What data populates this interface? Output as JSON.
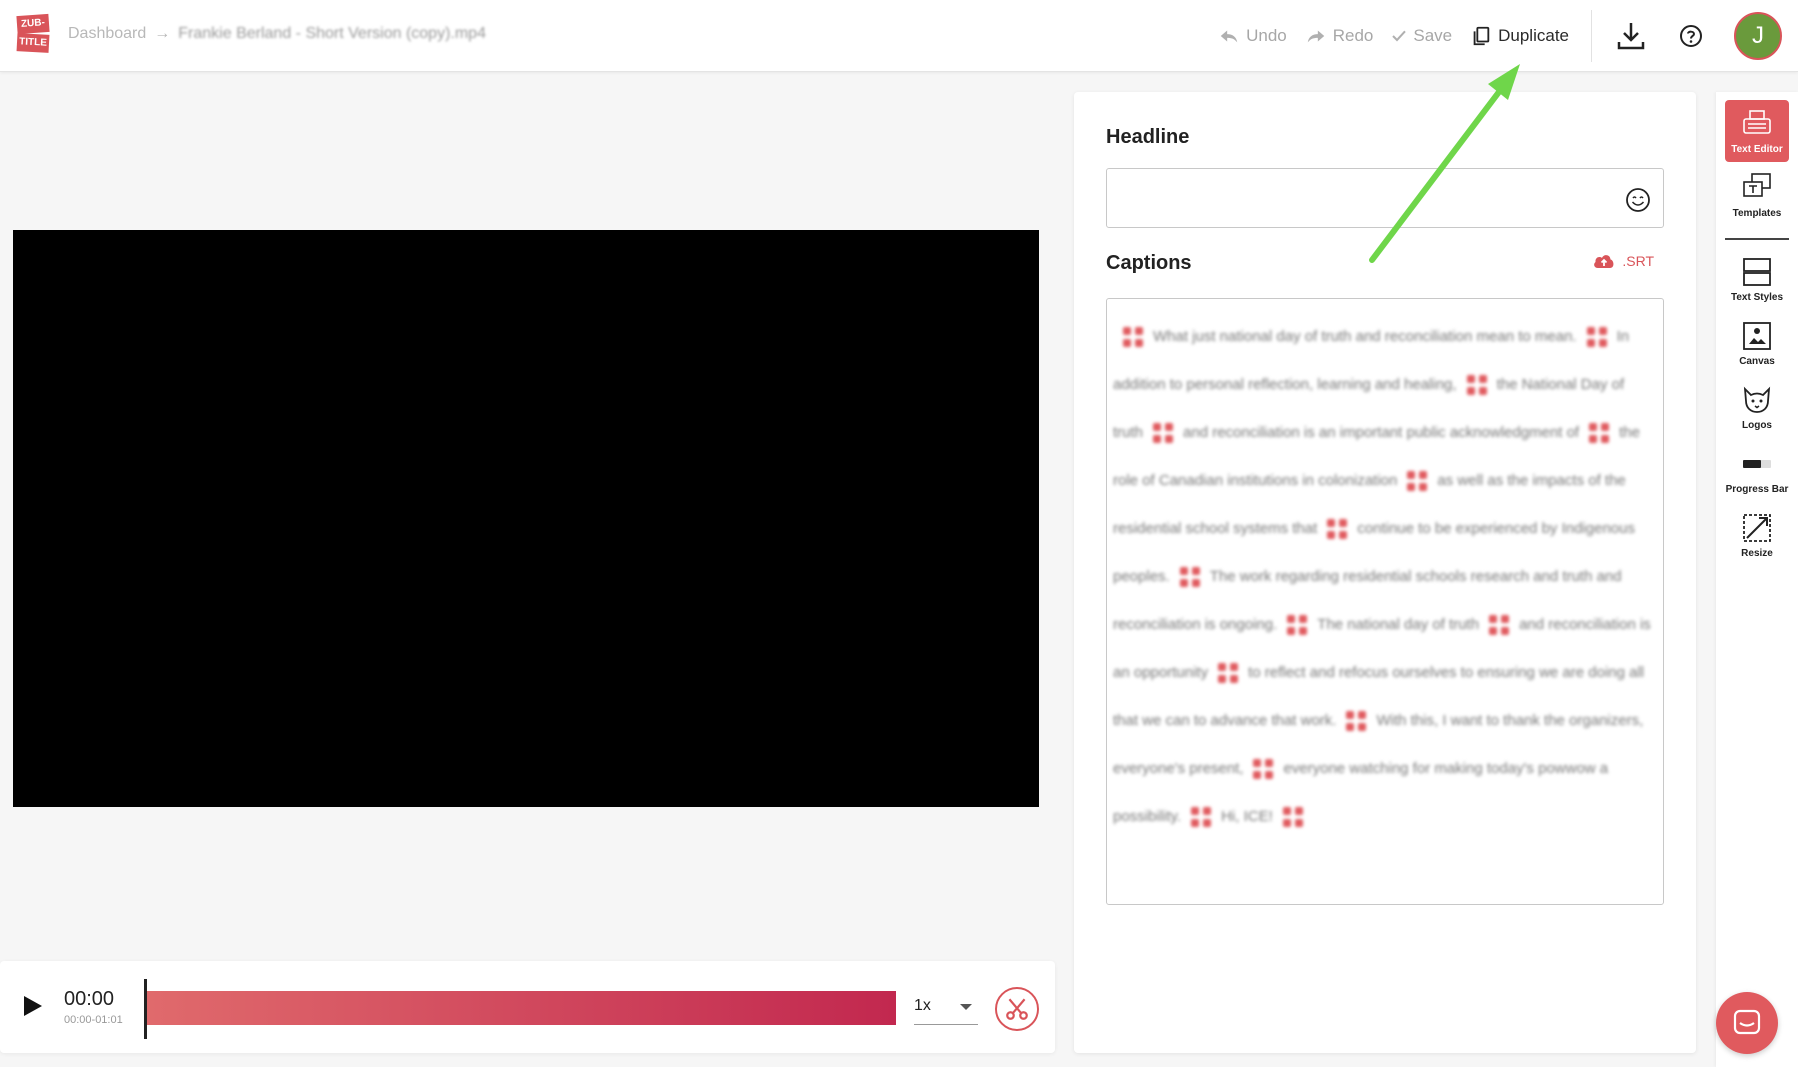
{
  "header": {
    "logo_top": "ZUB-",
    "logo_bottom": "TITLE",
    "breadcrumb_dashboard": "Dashboard",
    "breadcrumb_separator": "→",
    "breadcrumb_file": "Frankie Berland - Short Version (copy).mp4",
    "undo_label": "Undo",
    "redo_label": "Redo",
    "save_label": "Save",
    "duplicate_label": "Duplicate",
    "avatar_initial": "J"
  },
  "player": {
    "time": "00:00",
    "range": "00:00-01:01",
    "speed": "1x"
  },
  "editor": {
    "headline_label": "Headline",
    "headline_value": "",
    "captions_label": "Captions",
    "srt_label": ".SRT",
    "captions": [
      "What just national day of truth and reconciliation mean to mean.",
      "In addition to personal reflection, learning and healing,",
      "the National Day of truth",
      "and reconciliation is an important public acknowledgment of",
      "the role of Canadian institutions in colonization",
      "as well as the impacts of the residential school systems that",
      "continue to be experienced by Indigenous peoples.",
      "The work regarding residential schools research and truth and reconciliation is ongoing.",
      "The national day of truth",
      "and reconciliation is an opportunity",
      "to reflect and refocus ourselves to ensuring we are doing all that we can to advance that work.",
      "With this, I want to thank the organizers, everyone's present,",
      "everyone watching for making today's powwow a possibility.",
      "Hi, ICE!"
    ]
  },
  "sidebar": {
    "items": [
      {
        "label": "Text Editor"
      },
      {
        "label": "Templates"
      },
      {
        "label": "Text Styles"
      },
      {
        "label": "Canvas"
      },
      {
        "label": "Logos"
      },
      {
        "label": "Progress Bar"
      },
      {
        "label": "Resize"
      }
    ]
  },
  "colors": {
    "accent": "#e05a5e",
    "progress_start": "#e06a6c",
    "progress_end": "#c2284f",
    "annotation_arrow": "#6fd64a",
    "avatar_bg": "#6a9a3c"
  }
}
